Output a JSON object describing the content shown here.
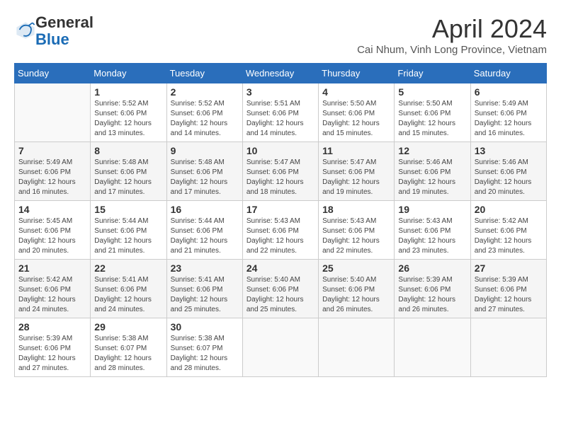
{
  "header": {
    "logo_general": "General",
    "logo_blue": "Blue",
    "month_title": "April 2024",
    "location": "Cai Nhum, Vinh Long Province, Vietnam"
  },
  "weekdays": [
    "Sunday",
    "Monday",
    "Tuesday",
    "Wednesday",
    "Thursday",
    "Friday",
    "Saturday"
  ],
  "weeks": [
    [
      {
        "day": "",
        "info": ""
      },
      {
        "day": "1",
        "info": "Sunrise: 5:52 AM\nSunset: 6:06 PM\nDaylight: 12 hours\nand 13 minutes."
      },
      {
        "day": "2",
        "info": "Sunrise: 5:52 AM\nSunset: 6:06 PM\nDaylight: 12 hours\nand 14 minutes."
      },
      {
        "day": "3",
        "info": "Sunrise: 5:51 AM\nSunset: 6:06 PM\nDaylight: 12 hours\nand 14 minutes."
      },
      {
        "day": "4",
        "info": "Sunrise: 5:50 AM\nSunset: 6:06 PM\nDaylight: 12 hours\nand 15 minutes."
      },
      {
        "day": "5",
        "info": "Sunrise: 5:50 AM\nSunset: 6:06 PM\nDaylight: 12 hours\nand 15 minutes."
      },
      {
        "day": "6",
        "info": "Sunrise: 5:49 AM\nSunset: 6:06 PM\nDaylight: 12 hours\nand 16 minutes."
      }
    ],
    [
      {
        "day": "7",
        "info": "Sunrise: 5:49 AM\nSunset: 6:06 PM\nDaylight: 12 hours\nand 16 minutes."
      },
      {
        "day": "8",
        "info": "Sunrise: 5:48 AM\nSunset: 6:06 PM\nDaylight: 12 hours\nand 17 minutes."
      },
      {
        "day": "9",
        "info": "Sunrise: 5:48 AM\nSunset: 6:06 PM\nDaylight: 12 hours\nand 17 minutes."
      },
      {
        "day": "10",
        "info": "Sunrise: 5:47 AM\nSunset: 6:06 PM\nDaylight: 12 hours\nand 18 minutes."
      },
      {
        "day": "11",
        "info": "Sunrise: 5:47 AM\nSunset: 6:06 PM\nDaylight: 12 hours\nand 19 minutes."
      },
      {
        "day": "12",
        "info": "Sunrise: 5:46 AM\nSunset: 6:06 PM\nDaylight: 12 hours\nand 19 minutes."
      },
      {
        "day": "13",
        "info": "Sunrise: 5:46 AM\nSunset: 6:06 PM\nDaylight: 12 hours\nand 20 minutes."
      }
    ],
    [
      {
        "day": "14",
        "info": "Sunrise: 5:45 AM\nSunset: 6:06 PM\nDaylight: 12 hours\nand 20 minutes."
      },
      {
        "day": "15",
        "info": "Sunrise: 5:44 AM\nSunset: 6:06 PM\nDaylight: 12 hours\nand 21 minutes."
      },
      {
        "day": "16",
        "info": "Sunrise: 5:44 AM\nSunset: 6:06 PM\nDaylight: 12 hours\nand 21 minutes."
      },
      {
        "day": "17",
        "info": "Sunrise: 5:43 AM\nSunset: 6:06 PM\nDaylight: 12 hours\nand 22 minutes."
      },
      {
        "day": "18",
        "info": "Sunrise: 5:43 AM\nSunset: 6:06 PM\nDaylight: 12 hours\nand 22 minutes."
      },
      {
        "day": "19",
        "info": "Sunrise: 5:43 AM\nSunset: 6:06 PM\nDaylight: 12 hours\nand 23 minutes."
      },
      {
        "day": "20",
        "info": "Sunrise: 5:42 AM\nSunset: 6:06 PM\nDaylight: 12 hours\nand 23 minutes."
      }
    ],
    [
      {
        "day": "21",
        "info": "Sunrise: 5:42 AM\nSunset: 6:06 PM\nDaylight: 12 hours\nand 24 minutes."
      },
      {
        "day": "22",
        "info": "Sunrise: 5:41 AM\nSunset: 6:06 PM\nDaylight: 12 hours\nand 24 minutes."
      },
      {
        "day": "23",
        "info": "Sunrise: 5:41 AM\nSunset: 6:06 PM\nDaylight: 12 hours\nand 25 minutes."
      },
      {
        "day": "24",
        "info": "Sunrise: 5:40 AM\nSunset: 6:06 PM\nDaylight: 12 hours\nand 25 minutes."
      },
      {
        "day": "25",
        "info": "Sunrise: 5:40 AM\nSunset: 6:06 PM\nDaylight: 12 hours\nand 26 minutes."
      },
      {
        "day": "26",
        "info": "Sunrise: 5:39 AM\nSunset: 6:06 PM\nDaylight: 12 hours\nand 26 minutes."
      },
      {
        "day": "27",
        "info": "Sunrise: 5:39 AM\nSunset: 6:06 PM\nDaylight: 12 hours\nand 27 minutes."
      }
    ],
    [
      {
        "day": "28",
        "info": "Sunrise: 5:39 AM\nSunset: 6:06 PM\nDaylight: 12 hours\nand 27 minutes."
      },
      {
        "day": "29",
        "info": "Sunrise: 5:38 AM\nSunset: 6:07 PM\nDaylight: 12 hours\nand 28 minutes."
      },
      {
        "day": "30",
        "info": "Sunrise: 5:38 AM\nSunset: 6:07 PM\nDaylight: 12 hours\nand 28 minutes."
      },
      {
        "day": "",
        "info": ""
      },
      {
        "day": "",
        "info": ""
      },
      {
        "day": "",
        "info": ""
      },
      {
        "day": "",
        "info": ""
      }
    ]
  ]
}
